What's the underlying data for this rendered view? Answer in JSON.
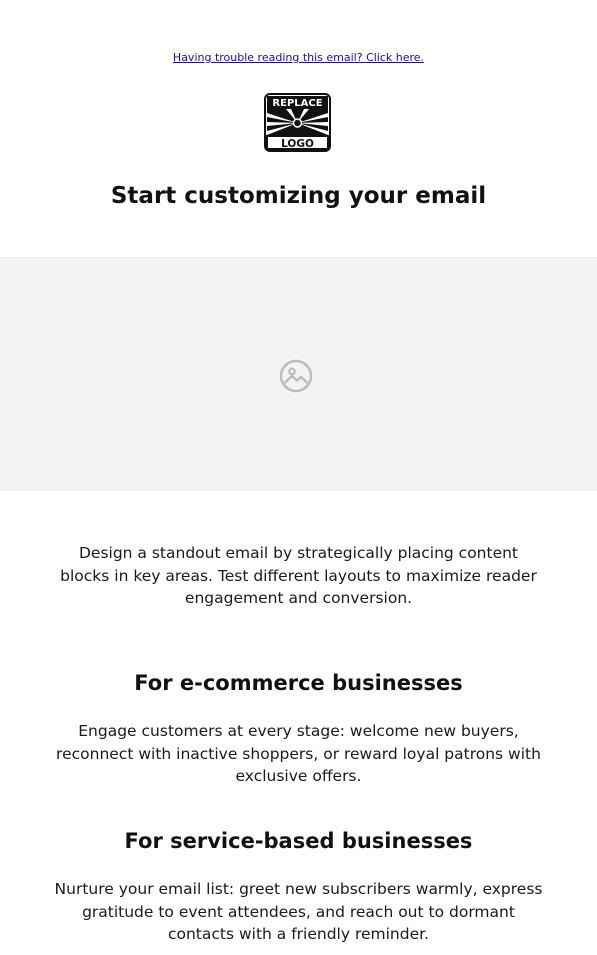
{
  "header": {
    "trouble_link": "Having trouble reading this email? Click here."
  },
  "logo": {
    "icon": "replace-logo-icon",
    "text_top": "REPLACE",
    "text_bottom": "LOGO"
  },
  "hero": {
    "title": "Start customizing your email",
    "image_icon": "image-placeholder-icon",
    "background_color": "#f3f3f1"
  },
  "intro": {
    "text": "Design a standout email by strategically placing content blocks in key areas. Test different layouts to maximize reader engagement and conversion."
  },
  "sections": [
    {
      "title": "For e-commerce businesses",
      "body": "Engage customers at every stage: welcome new buyers, reconnect with inactive shoppers, or reward loyal patrons with exclusive offers."
    },
    {
      "title": "For service-based businesses",
      "body": "Nurture your email list: greet new subscribers warmly, express gratitude to event attendees, and reach out to dormant contacts with a friendly reminder."
    }
  ],
  "colors": {
    "link": "#1a0dab",
    "text": "#111111",
    "placeholder_bg": "#f3f3f1"
  }
}
